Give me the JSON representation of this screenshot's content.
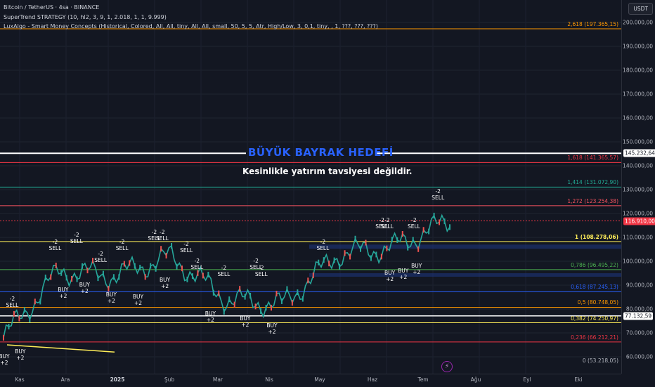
{
  "legend": {
    "symbol": "Bitcoin / TetherUS · 4sa · BINANCE",
    "indicator1": "SuperTrend STRATEGY (10, hl2, 3, 9, 1, 2.018, 1, 1, 9.999)",
    "indicator2": "LuxAlgo - Smart Money Concepts (Historical, Colored, All, All, tiny, All, All, small, 50, 5, 5, Atr, High/Low, 3, 0,1, tiny, , 1, ???, ???, ???)"
  },
  "currency_button": "USDT",
  "headline": "BÜYÜK BAYRAK HEDEFİ",
  "subline": "Kesinlikle yatırım tavsiyesi değildir.",
  "price_axis": {
    "ticks": [
      "200.000,00",
      "190.000,00",
      "180.000,00",
      "170.000,00",
      "160.000,00",
      "150.000,00",
      "140.000,00",
      "130.000,00",
      "120.000,00",
      "110.000,00",
      "100.000,00",
      "90.000,00",
      "80.000,00",
      "70.000,00",
      "60.000,00"
    ],
    "tick_values": [
      200000,
      190000,
      180000,
      170000,
      160000,
      150000,
      140000,
      130000,
      120000,
      110000,
      100000,
      90000,
      80000,
      70000,
      60000
    ],
    "target_price": "145.232,64",
    "current_price": "116.910,00",
    "low_marker": "77.132,59"
  },
  "time_axis": {
    "labels": [
      "Kas",
      "Ara",
      "2025",
      "Şub",
      "Mar",
      "Nis",
      "May",
      "Haz",
      "Tem",
      "Ağu",
      "Eyl",
      "Eki"
    ]
  },
  "fib_levels": [
    {
      "label": "2,618 (197.365,15)",
      "value": 197365,
      "color": "#ff9800"
    },
    {
      "label": "1,618 (141.365,57)",
      "value": 141365,
      "color": "#f23645"
    },
    {
      "label": "1,414 (131.072,90)",
      "value": 131072,
      "color": "#22ab94"
    },
    {
      "label": "1,272 (123.254,38)",
      "value": 123254,
      "color": "#f7525f"
    },
    {
      "label": "1 (108.278,06)",
      "value": 108278,
      "color": "#ffee58"
    },
    {
      "label": "0,786 (96.495,22)",
      "value": 96495,
      "color": "#4caf50"
    },
    {
      "label": "0,618 (87.245,13)",
      "value": 87245,
      "color": "#2962ff"
    },
    {
      "label": "0,5 (80.748,05)",
      "value": 80748,
      "color": "#ff9800"
    },
    {
      "label": "0,382 (74.250,97)",
      "value": 74250,
      "color": "#ffee58"
    },
    {
      "label": "0,236 (66.212,21)",
      "value": 66212,
      "color": "#f23645"
    },
    {
      "label": "0 (53.218,05)",
      "value": 53218,
      "color": "#b2b5be"
    }
  ],
  "signals": [
    {
      "text": "BUY",
      "sub": "+2",
      "month": 0.0,
      "price": 62000,
      "kind": "buy"
    },
    {
      "text": "SELL",
      "sub": "-2",
      "month": 0.15,
      "price": 79000,
      "kind": "sell"
    },
    {
      "text": "BUY",
      "sub": "+2",
      "month": 0.3,
      "price": 64000,
      "kind": "buy"
    },
    {
      "text": "SELL",
      "sub": "-2",
      "month": 0.95,
      "price": 103000,
      "kind": "sell"
    },
    {
      "text": "BUY",
      "sub": "+2",
      "month": 1.1,
      "price": 90000,
      "kind": "buy"
    },
    {
      "text": "SELL",
      "sub": "-2",
      "month": 1.35,
      "price": 106000,
      "kind": "sell"
    },
    {
      "text": "BUY",
      "sub": "+2",
      "month": 1.5,
      "price": 92000,
      "kind": "buy"
    },
    {
      "text": "SELL",
      "sub": "-2",
      "month": 1.8,
      "price": 98000,
      "kind": "sell"
    },
    {
      "text": "BUY",
      "sub": "+2",
      "month": 2.0,
      "price": 88000,
      "kind": "buy"
    },
    {
      "text": "SELL",
      "sub": "-2",
      "month": 2.2,
      "price": 103000,
      "kind": "sell"
    },
    {
      "text": "BUY",
      "sub": "+2",
      "month": 2.5,
      "price": 87000,
      "kind": "buy"
    },
    {
      "text": "SELL",
      "sub": "-2",
      "month": 2.8,
      "price": 107000,
      "kind": "sell"
    },
    {
      "text": "SELL",
      "sub": "-2",
      "month": 2.95,
      "price": 107000,
      "kind": "sell"
    },
    {
      "text": "BUY",
      "sub": "+2",
      "month": 3.0,
      "price": 94000,
      "kind": "buy"
    },
    {
      "text": "SELL",
      "sub": "-2",
      "month": 3.4,
      "price": 102000,
      "kind": "sell"
    },
    {
      "text": "SELL",
      "sub": "-2",
      "month": 3.6,
      "price": 95000,
      "kind": "sell"
    },
    {
      "text": "BUY",
      "sub": "+2",
      "month": 3.85,
      "price": 80000,
      "kind": "buy"
    },
    {
      "text": "SELL",
      "sub": "-2",
      "month": 4.1,
      "price": 92000,
      "kind": "sell"
    },
    {
      "text": "BUY",
      "sub": "+2",
      "month": 4.5,
      "price": 78000,
      "kind": "buy"
    },
    {
      "text": "SELL",
      "sub": "-2",
      "month": 4.7,
      "price": 95000,
      "kind": "sell"
    },
    {
      "text": "SELL",
      "sub": "-2",
      "month": 4.8,
      "price": 92000,
      "kind": "sell"
    },
    {
      "text": "BUY",
      "sub": "+2",
      "month": 5.0,
      "price": 75000,
      "kind": "buy"
    },
    {
      "text": "SELL",
      "sub": "-2",
      "month": 5.95,
      "price": 103000,
      "kind": "sell"
    },
    {
      "text": "SELL",
      "sub": "-2",
      "month": 7.05,
      "price": 112000,
      "kind": "sell"
    },
    {
      "text": "SELL",
      "sub": "-2",
      "month": 7.15,
      "price": 112000,
      "kind": "sell"
    },
    {
      "text": "BUY",
      "sub": "+2",
      "month": 7.2,
      "price": 97000,
      "kind": "buy"
    },
    {
      "text": "BUY",
      "sub": "+2",
      "month": 7.45,
      "price": 98000,
      "kind": "buy"
    },
    {
      "text": "SELL",
      "sub": "-2",
      "month": 7.65,
      "price": 112000,
      "kind": "sell"
    },
    {
      "text": "BUY",
      "sub": "+2",
      "month": 7.7,
      "price": 100000,
      "kind": "buy"
    },
    {
      "text": "SELL",
      "sub": "-2",
      "month": 8.1,
      "price": 124000,
      "kind": "sell"
    }
  ],
  "chart_data": {
    "type": "line",
    "title": "",
    "xlabel": "",
    "ylabel": "",
    "ylim": [
      53218,
      205000
    ],
    "x": [
      "Kas",
      "Ara",
      "2025",
      "Şub",
      "Mar",
      "Nis",
      "May",
      "Haz",
      "Tem"
    ],
    "series": [
      {
        "values": [
          68000,
          96000,
          94000,
          102000,
          84000,
          82000,
          103000,
          106000,
          117000
        ]
      }
    ],
    "target": 145232.64,
    "current": 116910.0,
    "grid": false
  }
}
